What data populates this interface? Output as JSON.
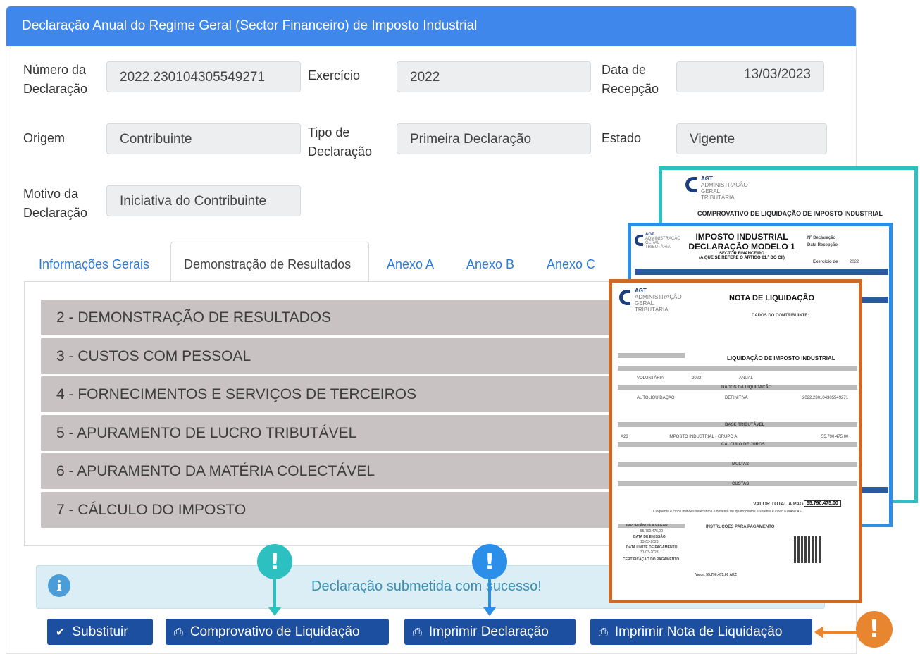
{
  "header": {
    "title": "Declaração Anual do Regime Geral (Sector Financeiro) de Imposto Industrial"
  },
  "form": {
    "numero_label": "Número da Declaração",
    "numero_value": "2022.230104305549271",
    "exercicio_label": "Exercício",
    "exercicio_value": "2022",
    "data_label": "Data de Recepção",
    "data_value": "13/03/2023",
    "origem_label": "Origem",
    "origem_value": "Contribuinte",
    "tipo_label": "Tipo de Declaração",
    "tipo_value": "Primeira Declaração",
    "estado_label": "Estado",
    "estado_value": "Vigente",
    "motivo_label": "Motivo da Declaração",
    "motivo_value": "Iniciativa do Contribuinte"
  },
  "tabs": [
    {
      "label": "Informações Gerais"
    },
    {
      "label": "Demonstração de Resultados"
    },
    {
      "label": "Anexo A"
    },
    {
      "label": "Anexo B"
    },
    {
      "label": "Anexo C"
    }
  ],
  "sections": [
    {
      "label": "2 - DEMONSTRAÇÃO DE RESULTADOS"
    },
    {
      "label": "3 - CUSTOS COM PESSOAL"
    },
    {
      "label": "4 - FORNECIMENTOS E SERVIÇOS DE TERCEIROS"
    },
    {
      "label": "5 - APURAMENTO DE LUCRO TRIBUTÁVEL"
    },
    {
      "label": "6 - APURAMENTO DA MATÉRIA COLECTÁVEL"
    },
    {
      "label": "7 - CÁLCULO DO IMPOSTO"
    }
  ],
  "alert": {
    "message": "Declaração submetida com sucesso!",
    "icon": "info-icon"
  },
  "buttons": {
    "substituir": "Substituir",
    "comprovativo": "Comprovativo de Liquidação",
    "imprimir_declaracao": "Imprimir Declaração",
    "imprimir_nota": "Imprimir Nota de Liquidação"
  },
  "documents": {
    "agt_short": "AGT",
    "agt_line1": "ADMINISTRAÇÃO",
    "agt_line2": "GERAL",
    "agt_line3": "TRIBUTÁRIA",
    "comprovativo_title": "COMPROVATIVO DE LIQUIDAÇÃO DE IMPOSTO INDUSTRIAL",
    "modelo_title1": "IMPOSTO INDUSTRIAL",
    "modelo_title2": "DECLARAÇÃO MODELO 1",
    "modelo_sub1": "SECTOR FINANCEIRO",
    "modelo_sub2": "(A QUE SE REFERE O ARTIGO 61.º DO CII)",
    "modelo_exercicio": "Exercício de",
    "modelo_exercicio_value": "2022",
    "modelo_ndecl": "Nº Declaração",
    "modelo_data": "Data Recepção",
    "nota_title": "NOTA DE LIQUIDAÇÃO",
    "nota_sub": "LIQUIDAÇÃO DE IMPOSTO INDUSTRIAL",
    "nota_contrib": "DADOS DO CONTRIBUINTE:",
    "nota_total_label": "VALOR TOTAL A PAGAR",
    "nota_total_value": "55.790.475,00",
    "nota_extenso": "Cinquenta e cinco milhões setecentos e noventa mil quatrocentos e setenta e cinco KWANZAS",
    "nota_instr": "INSTRUÇÕES PARA PAGAMENTO",
    "nota_importancia": "IMPORTÂNCIA A PAGAR",
    "nota_importancia_value": "55.790.475,00",
    "nota_data_emissao": "DATA DE EMISSÃO",
    "nota_data_emissao_value": "13-03-2023",
    "nota_data_limite": "DATA LIMITE DE PAGAMENTO",
    "nota_data_limite_value": "31-03-2023",
    "nota_certificacao": "CERTIFICAÇÃO DO PAGAMENTO",
    "nota_base": "BASE TRIBUTÁVEL",
    "nota_juros": "CÁLCULO DE JUROS",
    "nota_multas": "MULTAS",
    "nota_custas": "CUSTAS",
    "nota_dados_liq": "DADOS DA LIQUIDAÇÃO",
    "nota_autoliq": "AUTOLIQUIDAÇÃO",
    "nota_definitiva": "DEFINITIVA",
    "nota_voluntaria": "VOLUNTÁRIA",
    "nota_anual": "ANUAL",
    "nota_ano": "2022",
    "nota_receita": "IMPOSTO INDUSTRIAL - GRUPO A",
    "nota_codigo": "A23",
    "nota_valor": "55.790.475,00",
    "nota_ref": "230104305549271",
    "nota_doc_assoc": "2022.230104305549271",
    "nota_valor_akz": "Valor: 55.790.475,00 AKZ"
  },
  "colors": {
    "header": "#3f87ea",
    "button": "#1d4fa0",
    "teal": "#2dc0c0",
    "blue": "#2b8ee8",
    "orange": "#e8862f"
  }
}
